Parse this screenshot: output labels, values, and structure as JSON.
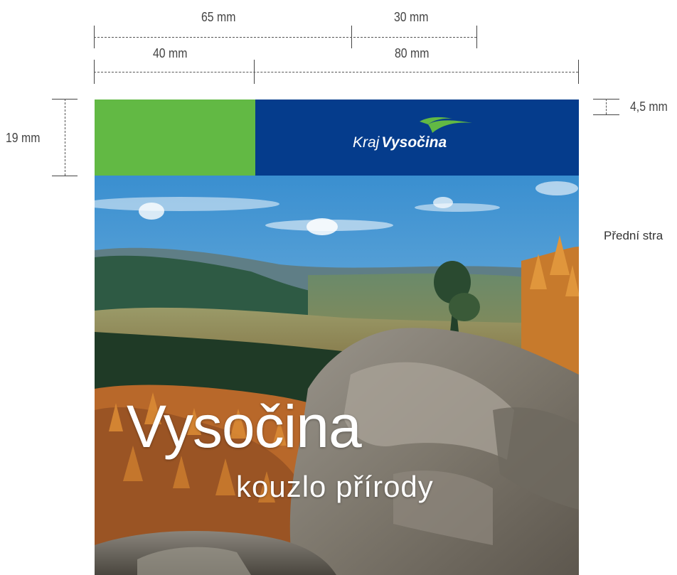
{
  "dimensions": {
    "top_left_width": "65 mm",
    "top_right_width": "30 mm",
    "bottom_left_width": "40 mm",
    "bottom_right_width": "80 mm",
    "band_height": "19 mm",
    "logo_height": "4,5 mm"
  },
  "header": {
    "logo_prefix": "Kraj",
    "logo_name": "Vysočina",
    "green_color": "#62b944",
    "blue_color": "#053c8c"
  },
  "cover": {
    "title": "Vysočina",
    "subtitle": "kouzlo přírody"
  },
  "side_label": "Přední stra"
}
